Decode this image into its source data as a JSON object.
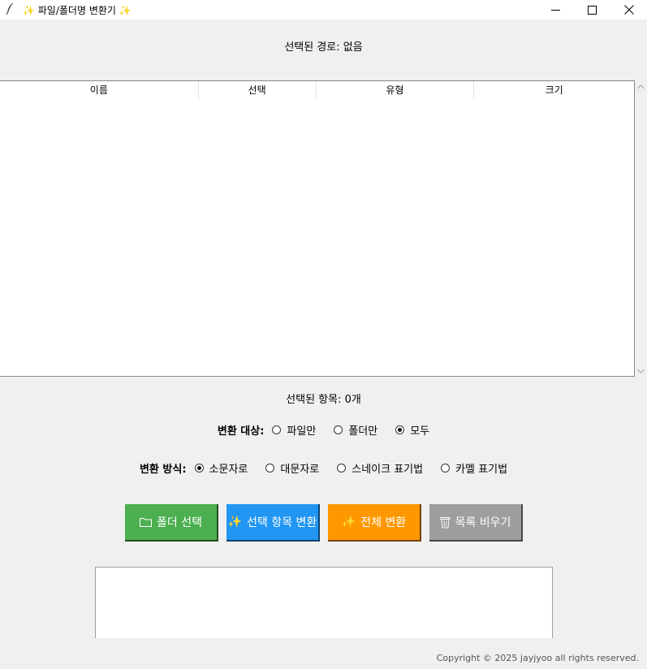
{
  "window": {
    "title": "✨ 파일/폴더명 변환기 ✨",
    "icon": "feather-icon",
    "controls": [
      "minimize-icon",
      "maximize-icon",
      "close-icon"
    ]
  },
  "path": {
    "text": "선택된 경로: 없음"
  },
  "table": {
    "columns": [
      "이름",
      "선택",
      "유형",
      "크기"
    ],
    "rows": []
  },
  "selection": {
    "text": "선택된 항목: 0개"
  },
  "target": {
    "label": "변환 대상:",
    "options": [
      "파일만",
      "폴더만",
      "모두"
    ],
    "selected": "모두"
  },
  "method": {
    "label": "변환 방식:",
    "options": [
      "소문자로",
      "대문자로",
      "스네이크 표기법",
      "카멜 표기법"
    ],
    "selected": "소문자로"
  },
  "buttons": [
    {
      "label": "폴더 선택",
      "icon": "folder-icon",
      "color": "#4caf50"
    },
    {
      "label": "선택 항목 변환",
      "icon": "sparkles-icon",
      "color": "#2196f3"
    },
    {
      "label": "전체 변환",
      "icon": "sparkles-icon",
      "color": "#ff9800"
    },
    {
      "label": "목록 비우기",
      "icon": "trash-icon",
      "color": "#9e9e9e"
    }
  ],
  "log": {
    "text": ""
  },
  "footer": {
    "copyright": "Copyright © 2025 jayjyoo all rights reserved."
  }
}
